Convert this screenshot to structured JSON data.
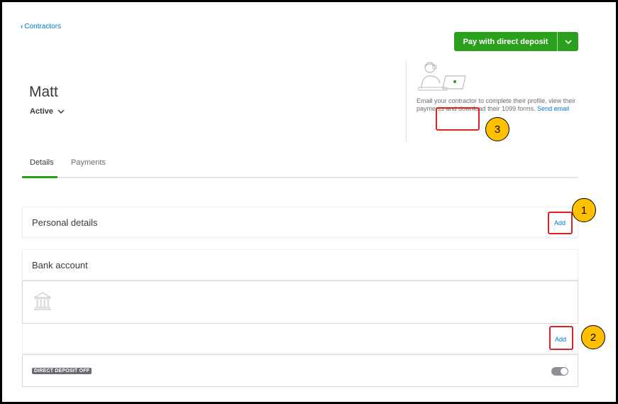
{
  "nav": {
    "back_label": "Contractors"
  },
  "actions": {
    "pay_label": "Pay with direct deposit"
  },
  "contractor": {
    "name": "Matt",
    "status": "Active"
  },
  "promo": {
    "text": "Email your contractor to complete their profile, view their payments and download their 1099 forms.",
    "link_label": "Send email"
  },
  "tabs": [
    {
      "label": "Details"
    },
    {
      "label": "Payments"
    }
  ],
  "personal_details": {
    "title": "Personal details",
    "add_label": "Add"
  },
  "bank_account": {
    "title": "Bank account",
    "add_label": "Add"
  },
  "direct_deposit": {
    "badge": "DIRECT DEPOSIT OFF"
  },
  "callouts": [
    "1",
    "2",
    "3"
  ],
  "colors": {
    "accent": "#2ca01c",
    "link": "#0077c5",
    "highlight": "#e02020",
    "callout": "#ffc000"
  }
}
